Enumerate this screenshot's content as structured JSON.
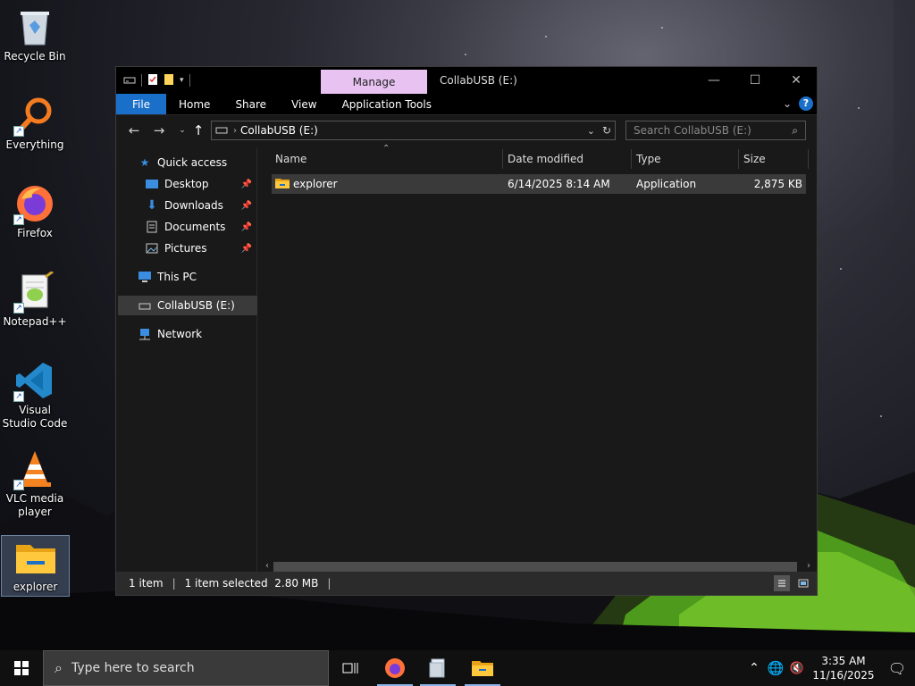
{
  "desktop": {
    "icons": [
      {
        "label": "Recycle Bin"
      },
      {
        "label": "Everything"
      },
      {
        "label": "Firefox"
      },
      {
        "label": "Notepad++"
      },
      {
        "label": "Visual Studio Code"
      },
      {
        "label": "VLC media player"
      },
      {
        "label": "explorer"
      }
    ]
  },
  "window": {
    "title": "CollabUSB (E:)",
    "contextual_tab": "Manage",
    "ribbon_tabs": [
      "File",
      "Home",
      "Share",
      "View",
      "Application Tools"
    ],
    "address": {
      "path": "CollabUSB (E:)",
      "search_placeholder": "Search CollabUSB (E:)"
    },
    "nav": {
      "quick_access": "Quick access",
      "pinned": [
        "Desktop",
        "Downloads",
        "Documents",
        "Pictures"
      ],
      "this_pc": "This PC",
      "drive": "CollabUSB (E:)",
      "network": "Network"
    },
    "columns": [
      "Name",
      "Date modified",
      "Type",
      "Size"
    ],
    "files": [
      {
        "name": "explorer",
        "date": "6/14/2025 8:14 AM",
        "type": "Application",
        "size": "2,875 KB"
      }
    ],
    "status": {
      "items": "1 item",
      "selected": "1 item selected  2.80 MB"
    }
  },
  "taskbar": {
    "search_placeholder": "Type here to search",
    "time": "3:35 AM",
    "date": "11/16/2025"
  },
  "colors": {
    "accent": "#1a6fc9",
    "manage_tab": "#e8c3f2",
    "window_bg": "#191919",
    "selection": "#3a3a3a"
  }
}
